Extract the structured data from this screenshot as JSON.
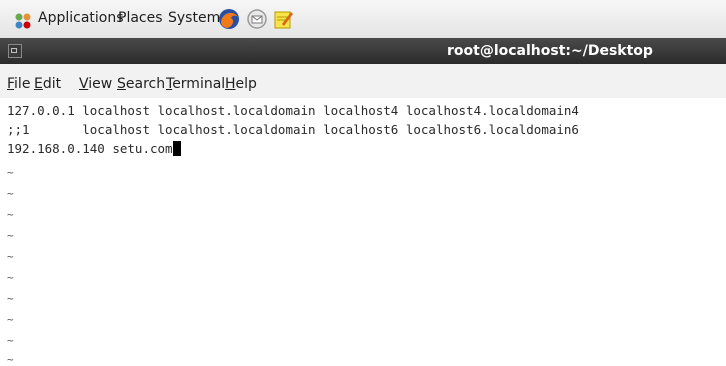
{
  "panel": {
    "menus": [
      "Applications",
      "Places",
      "System"
    ],
    "launchers": [
      "firefox-icon",
      "mail-client-icon",
      "text-editor-icon"
    ]
  },
  "window": {
    "title": "root@localhost:~/Desktop"
  },
  "menubar": {
    "items": [
      {
        "first": "F",
        "rest": "ile"
      },
      {
        "first": "E",
        "rest": "dit"
      },
      {
        "first": "V",
        "rest": "iew"
      },
      {
        "first": "S",
        "rest": "earch"
      },
      {
        "first": "T",
        "rest": "erminal"
      },
      {
        "first": "H",
        "rest": "elp"
      }
    ]
  },
  "editor": {
    "lines": [
      "127.0.0.1 localhost localhost.localdomain localhost4 localhost4.localdomain4",
      ";;1       localhost localhost.localdomain localhost6 localhost6.localdomain6",
      "192.168.0.140 setu.com"
    ],
    "tilde": "~"
  }
}
